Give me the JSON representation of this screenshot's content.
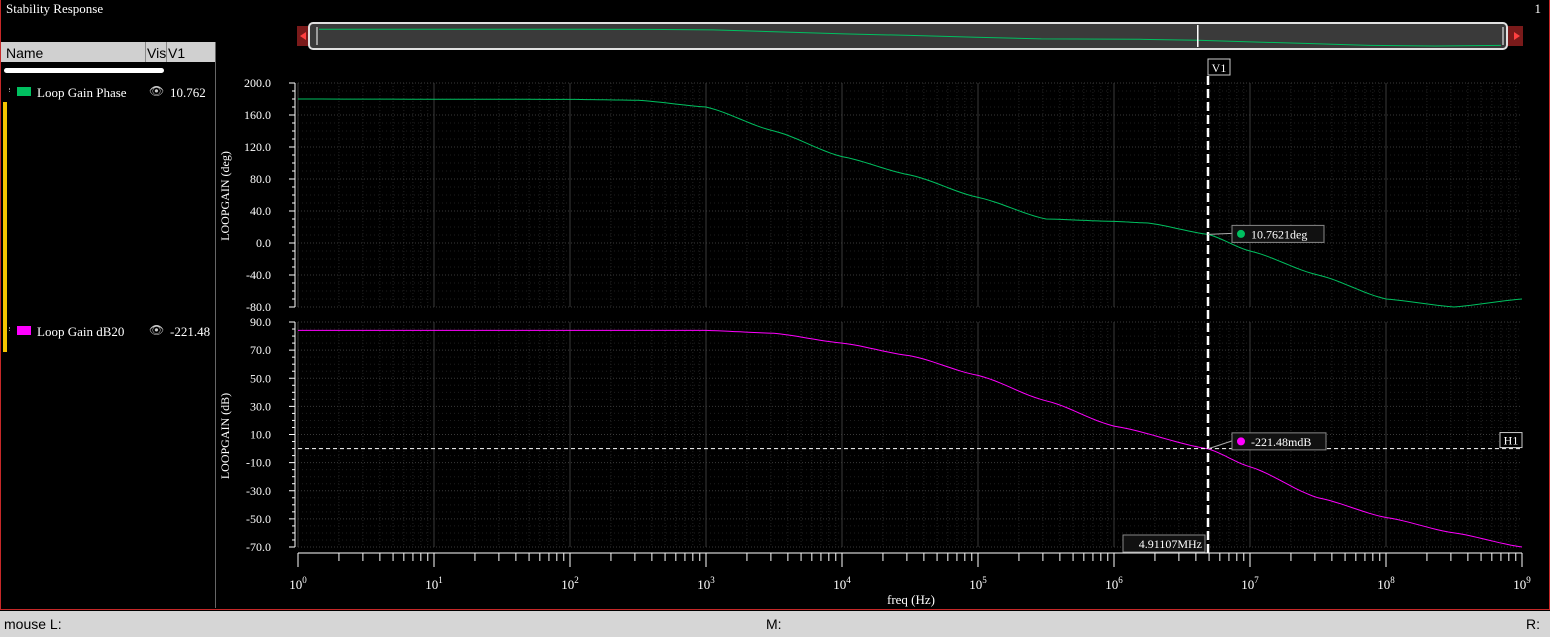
{
  "window": {
    "title": "Stability Response",
    "number": "1"
  },
  "legend": {
    "headers": {
      "name": "Name",
      "vis": "Vis",
      "v1": "V1"
    },
    "items": [
      {
        "name": "Loop Gain Phase",
        "value": "10.762",
        "color": "#00c060"
      },
      {
        "name": "Loop Gain dB20",
        "value": "-221.48",
        "color": "#ff00ff"
      }
    ]
  },
  "status": {
    "left": "mouse L:",
    "middle": "M:",
    "right": "R:"
  },
  "markers": {
    "vertical": {
      "label": "V1",
      "freq_label": "4.91107MHz",
      "freq": 4911070
    },
    "horizontal": {
      "label": "H1",
      "level": 0
    },
    "phase_readout": "10.7621deg",
    "gain_readout": "-221.48mdB"
  },
  "chart_data": [
    {
      "type": "line",
      "name": "phase",
      "ylabel": "LOOPGAIN (deg)",
      "xscale": "log",
      "xlim": [
        1,
        1000000000
      ],
      "ylim": [
        -80,
        200
      ],
      "yticks": [
        200.0,
        160.0,
        120.0,
        80.0,
        40.0,
        0.0,
        -40.0,
        -80.0
      ],
      "ytick_labels": [
        "200.0",
        "160.0",
        "120.0",
        "80.0",
        "40.0",
        "0.0",
        "-40.0",
        "-80.0"
      ],
      "grid": true,
      "series": [
        {
          "name": "Loop Gain Phase",
          "color": "#00c060",
          "points": [
            [
              1,
              180
            ],
            [
              100,
              179.5
            ],
            [
              316,
              178.5
            ],
            [
              1000,
              170
            ],
            [
              3162,
              140
            ],
            [
              10000,
              108
            ],
            [
              31623,
              85
            ],
            [
              100000,
              57
            ],
            [
              316228,
              30
            ],
            [
              1000000,
              27
            ],
            [
              1778279,
              25
            ],
            [
              4911070,
              10.76
            ],
            [
              10000000,
              -10
            ],
            [
              31622777,
              -40
            ],
            [
              100000000,
              -70
            ],
            [
              316227766,
              -80
            ],
            [
              1000000000,
              -70
            ]
          ]
        }
      ]
    },
    {
      "type": "line",
      "name": "gain",
      "ylabel": "LOOPGAIN (dB)",
      "xlabel": "freq (Hz)",
      "xscale": "log",
      "xlim": [
        1,
        1000000000
      ],
      "ylim": [
        -70,
        90
      ],
      "yticks": [
        90.0,
        70.0,
        50.0,
        30.0,
        10.0,
        -10.0,
        -30.0,
        -50.0,
        -70.0
      ],
      "ytick_labels": [
        "90.0",
        "70.0",
        "50.0",
        "30.0",
        "10.0",
        "-10.0",
        "-30.0",
        "-50.0",
        "-70.0"
      ],
      "xticks": [
        "10^0",
        "10^1",
        "10^2",
        "10^3",
        "10^4",
        "10^5",
        "10^6",
        "10^7",
        "10^8",
        "10^9"
      ],
      "grid": true,
      "series": [
        {
          "name": "Loop Gain dB20",
          "color": "#ff00ff",
          "points": [
            [
              1,
              84
            ],
            [
              100,
              84
            ],
            [
              1000,
              84
            ],
            [
              3162,
              82
            ],
            [
              10000,
              75
            ],
            [
              31623,
              66
            ],
            [
              100000,
              52
            ],
            [
              316228,
              34
            ],
            [
              1000000,
              16
            ],
            [
              4911070,
              -0.22
            ],
            [
              10000000,
              -13
            ],
            [
              31622777,
              -35
            ],
            [
              100000000,
              -49
            ],
            [
              316227766,
              -60
            ],
            [
              1000000000,
              -70
            ]
          ]
        }
      ]
    }
  ]
}
